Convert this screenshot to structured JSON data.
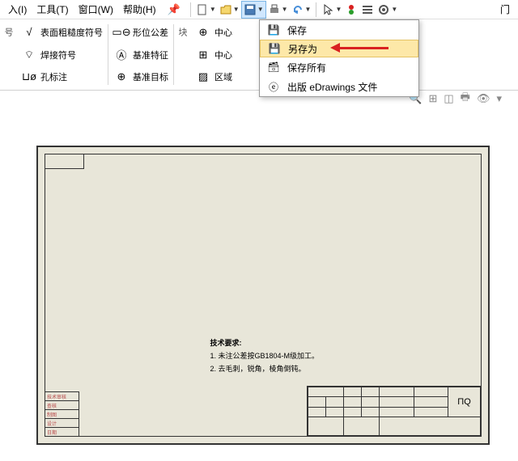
{
  "menubar": {
    "items": [
      "入(I)",
      "工具(T)",
      "窗口(W)",
      "帮助(H)"
    ],
    "right_item": "门"
  },
  "ribbon": {
    "group1": {
      "items": [
        {
          "icon": "√",
          "label": "表面粗糙度符号"
        },
        {
          "icon": "⌔",
          "label": "焊接符号"
        },
        {
          "icon": "⊔ø",
          "label": "孔标注"
        }
      ],
      "side_label": "号"
    },
    "group2": {
      "items": [
        {
          "icon": "▭⊖",
          "label": "形位公差"
        },
        {
          "icon": "Ⓐ",
          "label": "基准特征"
        },
        {
          "icon": "⊕",
          "label": "基准目标"
        }
      ]
    },
    "group3": {
      "label": "块",
      "items": [
        {
          "icon": "⊕",
          "label": "中心"
        },
        {
          "icon": "⊞",
          "label": "中心"
        },
        {
          "icon": "▨",
          "label": "区域"
        }
      ]
    }
  },
  "save_menu": {
    "items": [
      {
        "icon": "save",
        "label": "保存"
      },
      {
        "icon": "saveas",
        "label": "另存为",
        "highlighted": true
      },
      {
        "icon": "saveall",
        "label": "保存所有"
      },
      {
        "icon": "edrawings",
        "label": "出版 eDrawings 文件"
      }
    ]
  },
  "drawing": {
    "notes_title": "技术要求:",
    "notes_line1": "1. 未注公差按GB1804-M级加工。",
    "notes_line2": "2. 去毛刺，锐角，棱角倒钝。",
    "title_block_label": "ΠQ",
    "revision_labels": [
      "技术审核",
      "查核",
      "制图",
      "设计",
      "日期"
    ]
  }
}
